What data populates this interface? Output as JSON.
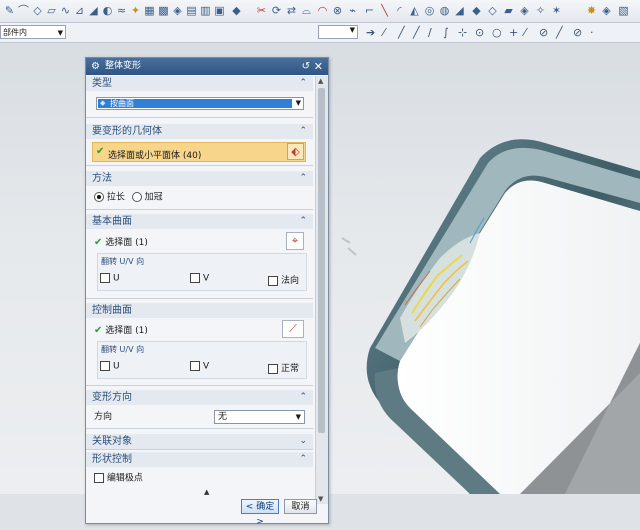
{
  "top_combo": {
    "value": "部件内"
  },
  "dialog": {
    "title": "整体变形",
    "sections": {
      "type": {
        "label": "类型",
        "selected": "按曲面"
      },
      "geometry": {
        "label": "要变形的几何体",
        "select_label": "选择面或小平面体 (40)"
      },
      "method": {
        "label": "方法",
        "options": [
          "拉长",
          "加冠"
        ],
        "selected": "拉长"
      },
      "base_surface": {
        "label": "基本曲面",
        "select_label": "选择面 (1)",
        "flip_label": "翻转 U/V 向",
        "options": [
          "U",
          "V",
          "法向"
        ]
      },
      "control_surface": {
        "label": "控制曲面",
        "select_label": "选择面 (1)",
        "flip_label": "翻转 U/V 向",
        "options": [
          "U",
          "V",
          "正常"
        ]
      },
      "deform_direction": {
        "label": "变形方向",
        "field_label": "方向",
        "value": "无"
      },
      "associated": {
        "label": "关联对象"
      },
      "shape_control": {
        "label": "形状控制",
        "option": "编辑极点"
      }
    },
    "buttons": {
      "ok": "< 确定 >",
      "cancel": "取消"
    }
  },
  "colors": {
    "title_bar": "#2e5584",
    "highlight_row": "#f7d58a",
    "select_highlight": "#2f7fd8",
    "check": "#2f9a2f"
  }
}
